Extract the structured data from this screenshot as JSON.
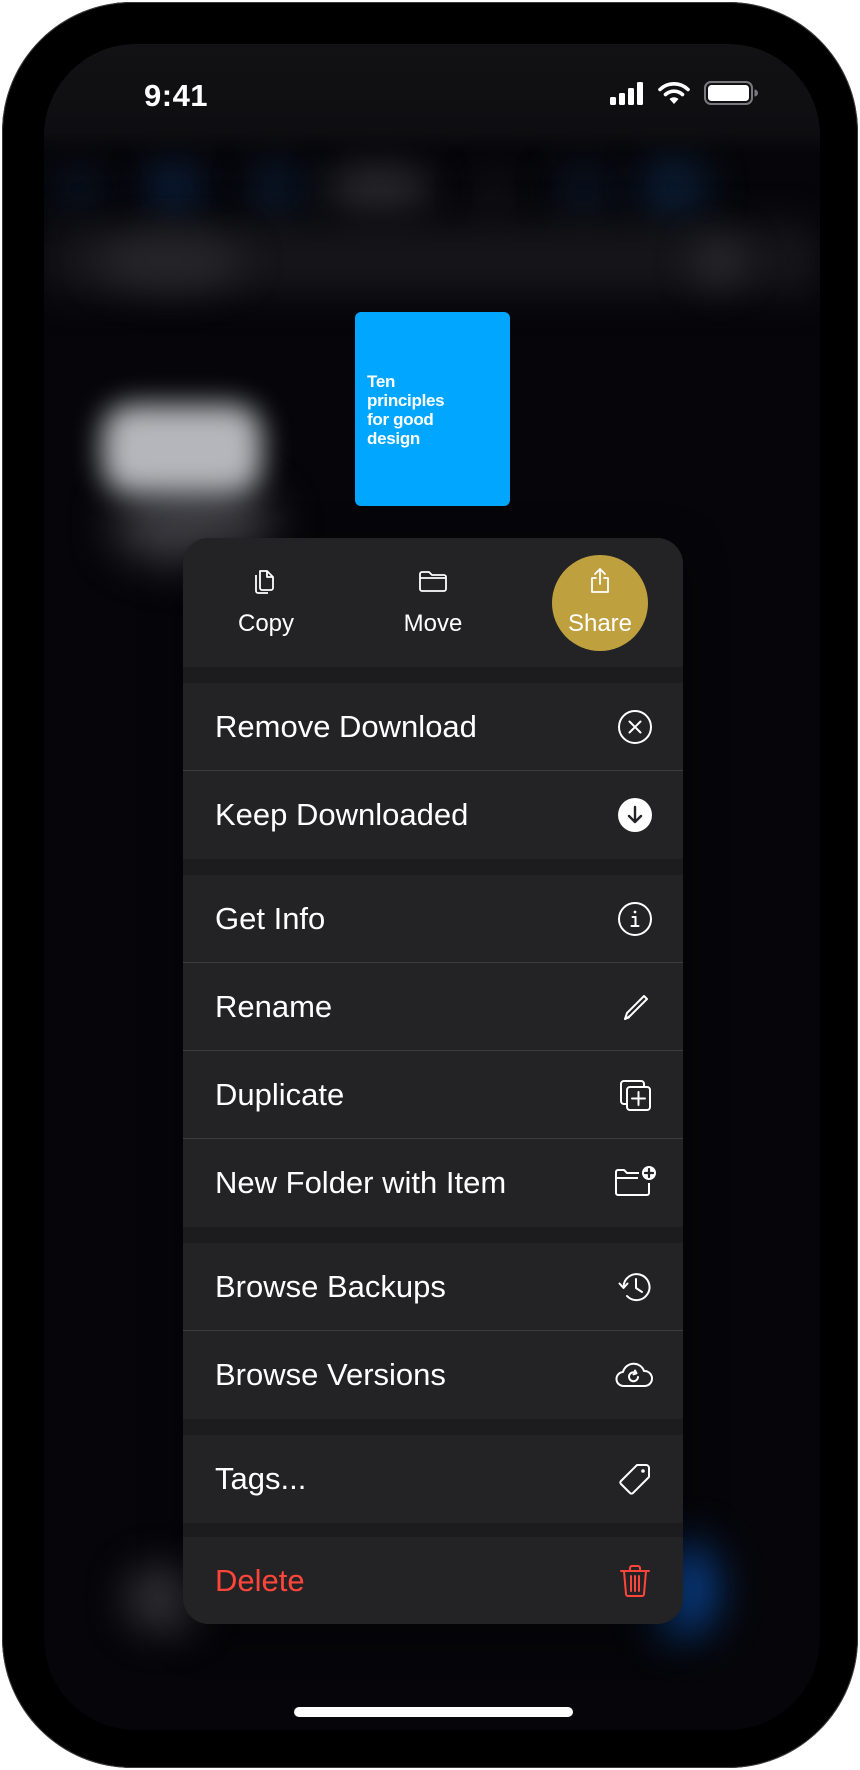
{
  "status_bar": {
    "time": "9:41",
    "icons": [
      "cellular-signal-icon",
      "wifi-icon",
      "battery-icon"
    ]
  },
  "document": {
    "title": "Ten\nprinciples\nfor good\ndesign",
    "cover_color": "#00a6ff"
  },
  "menu": {
    "quick_actions": [
      {
        "label": "Copy",
        "icon": "copy-icon"
      },
      {
        "label": "Move",
        "icon": "folder-icon"
      },
      {
        "label": "Share",
        "icon": "share-icon",
        "highlighted": true,
        "highlight_color": "#bfa03e"
      }
    ],
    "sections": [
      {
        "items": [
          {
            "label": "Remove Download",
            "icon": "xmark-circle-icon"
          },
          {
            "label": "Keep Downloaded",
            "icon": "arrow-down-circle-fill-icon"
          }
        ]
      },
      {
        "items": [
          {
            "label": "Get Info",
            "icon": "info-circle-icon"
          },
          {
            "label": "Rename",
            "icon": "pencil-icon"
          },
          {
            "label": "Duplicate",
            "icon": "plus-square-on-square-icon"
          },
          {
            "label": "New Folder with Item",
            "icon": "folder-badge-plus-icon"
          }
        ]
      },
      {
        "items": [
          {
            "label": "Browse Backups",
            "icon": "clock-arrow-circlepath-icon"
          },
          {
            "label": "Browse Versions",
            "icon": "cloud-arrow-circlepath-icon"
          }
        ]
      },
      {
        "items": [
          {
            "label": "Tags...",
            "icon": "tag-icon"
          }
        ]
      },
      {
        "items": [
          {
            "label": "Delete",
            "icon": "trash-icon",
            "destructive": true,
            "color": "#ff453a"
          }
        ]
      }
    ]
  }
}
